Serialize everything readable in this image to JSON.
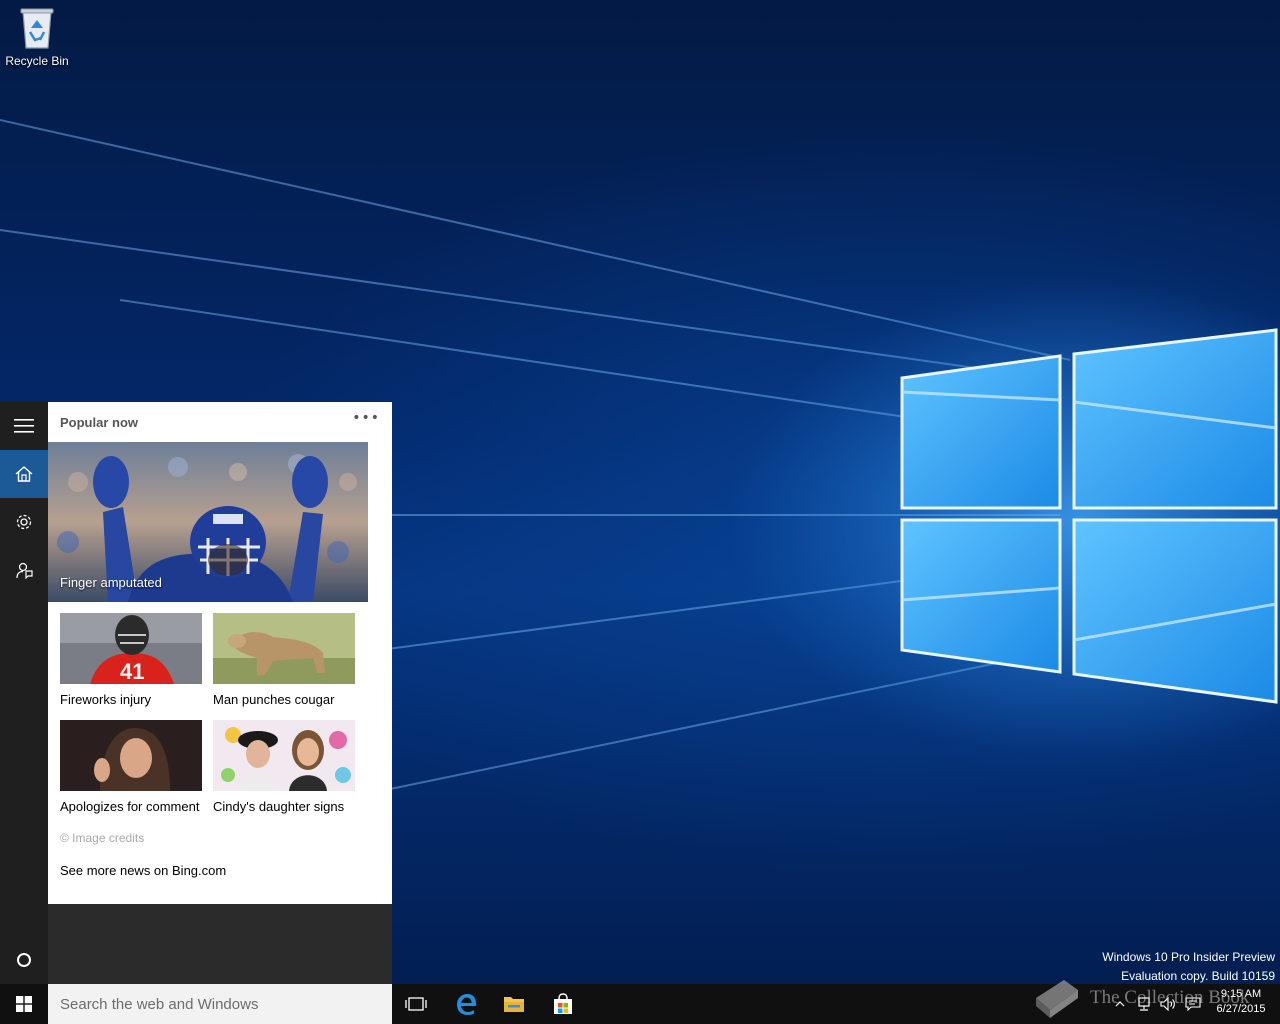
{
  "desktop": {
    "recycle_bin_label": "Recycle Bin",
    "evaluation_line1": "Windows 10 Pro Insider Preview",
    "evaluation_line2": "Evaluation copy. Build 10159"
  },
  "cortana": {
    "header": "Popular now",
    "more_icon": "ellipsis-icon",
    "hero": {
      "caption": "Finger amputated"
    },
    "tiles": [
      {
        "caption": "Fireworks injury"
      },
      {
        "caption": "Man punches cougar"
      },
      {
        "caption": "Apologizes for comment"
      },
      {
        "caption": "Cindy's daughter signs"
      }
    ],
    "credits": "© Image credits",
    "more_news_link": "See more news on Bing.com"
  },
  "rail": {
    "items": [
      "hamburger-icon",
      "home-icon",
      "settings-icon",
      "feedback-icon",
      "cortana-circle-icon"
    ],
    "active": "home-icon"
  },
  "taskbar": {
    "search_placeholder": "Search the web and Windows",
    "apps": [
      "task-view-icon",
      "edge-icon",
      "file-explorer-icon",
      "store-icon"
    ],
    "time": "9:15 AM",
    "date": "6/27/2015"
  },
  "watermark": {
    "text": "The Collection Book"
  },
  "colors": {
    "accent": "#1b5a96",
    "rail": "#1f1f1f",
    "taskbar": "#101010",
    "wallpaper": "#03286b"
  }
}
